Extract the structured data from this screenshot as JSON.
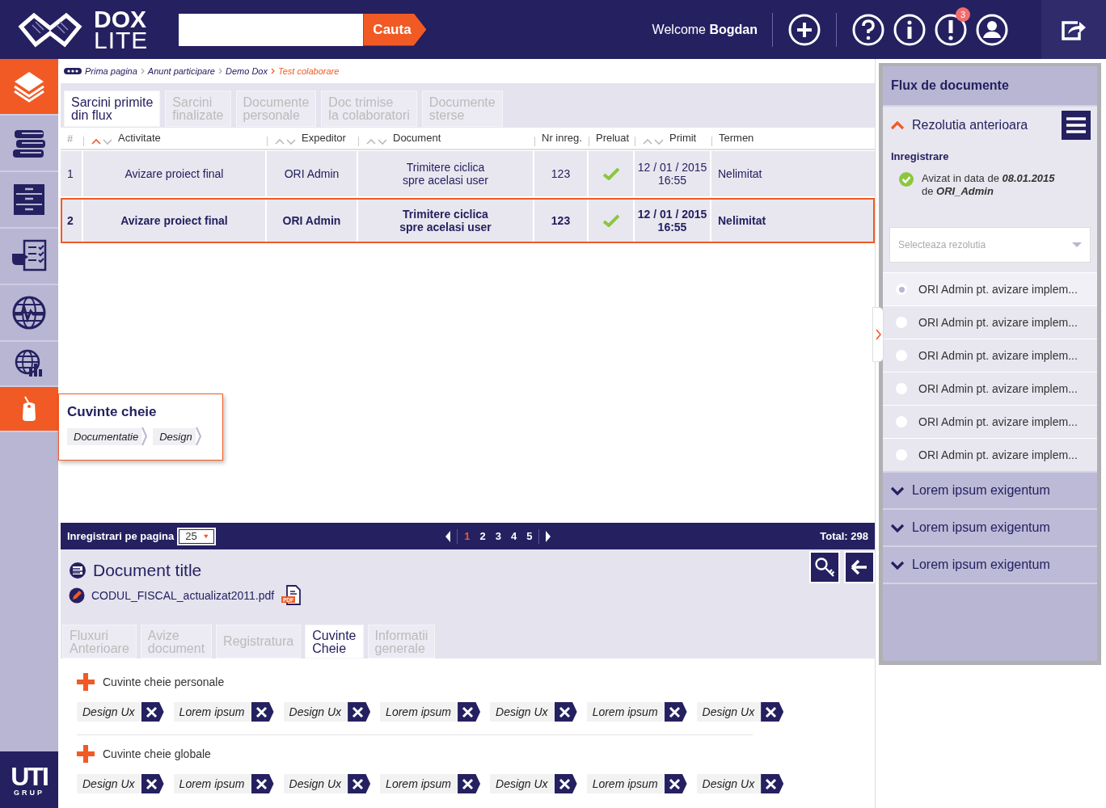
{
  "header": {
    "logo": {
      "top": "DOX",
      "bottom": "LITE"
    },
    "search": {
      "button": "Cauta"
    },
    "welcome": "Welcome **Bogdan**",
    "notification_badge": "3"
  },
  "sidebar": {
    "items": [
      {
        "kind": "layers",
        "selected": true
      },
      {
        "kind": "books",
        "selected": false
      },
      {
        "kind": "cabinet",
        "selected": false
      },
      {
        "kind": "checklist",
        "selected": false
      },
      {
        "kind": "globe",
        "selected": false
      },
      {
        "kind": "globe-chart",
        "selected": false
      },
      {
        "kind": "tag",
        "selected": true
      }
    ],
    "footer_logo": {
      "top": "UTI",
      "bottom": "GRUP"
    }
  },
  "breadcrumb": [
    {
      "label": "Prima pagina",
      "current": false
    },
    {
      "label": "Anunt participare",
      "current": false
    },
    {
      "label": "Demo Dox",
      "current": false
    },
    {
      "label": "Test colaborare",
      "current": true
    }
  ],
  "tabs": [
    {
      "label": "Sarcini primite\ndin flux",
      "selected": true
    },
    {
      "label": "Sarcini\nfinalizate",
      "selected": false
    },
    {
      "label": "Documente\npersonale",
      "selected": false
    },
    {
      "label": "Doc trimise\nla colaboratori",
      "selected": false
    },
    {
      "label": "Documente\nsterse",
      "selected": false
    }
  ],
  "table": {
    "columns": [
      {
        "label": "#",
        "sortable": false
      },
      {
        "label": "Activitate",
        "sorted": true,
        "sortable": true
      },
      {
        "label": "Expeditor",
        "sorted": false,
        "sortable": true
      },
      {
        "label": "Document",
        "sorted": false,
        "sortable": true
      },
      {
        "label": "Nr inreg.",
        "sortable": false
      },
      {
        "label": "Preluat",
        "sortable": false
      },
      {
        "label": "Primit",
        "sorted": false,
        "sortable": true
      },
      {
        "label": "Termen",
        "sortable": false
      }
    ],
    "rows": [
      {
        "number": "1",
        "activity": "Avizare proiect final",
        "sender": "ORI Admin",
        "document": "Trimitere ciclica\nspre acelasi user",
        "reg_no": "123",
        "taken": true,
        "date": "12 / 01 / 2015",
        "time": "16:55",
        "deadline": "Nelimitat",
        "selected": false
      },
      {
        "number": "2",
        "activity": "Avizare proiect final",
        "sender": "ORI Admin",
        "document": "Trimitere ciclica\nspre acelasi user",
        "reg_no": "123",
        "taken": true,
        "date": "12 / 01 / 2015",
        "time": "16:55",
        "deadline": "Nelimitat",
        "selected": true
      }
    ]
  },
  "keyword_popup": {
    "title": "Cuvinte cheie",
    "tags": [
      "Documentatie",
      "Design"
    ]
  },
  "pagination": {
    "label": "Inregistrari pe pagina",
    "per_page": "25",
    "pages": [
      {
        "label": "1",
        "selected": true
      },
      {
        "label": "2",
        "selected": false
      },
      {
        "label": "3",
        "selected": false
      },
      {
        "label": "4",
        "selected": false
      },
      {
        "label": "5",
        "selected": false
      }
    ],
    "total_label": "Total:",
    "total": "298"
  },
  "document": {
    "title": "Document title",
    "file": "CODUL_FISCAL_actualizat2011.pdf",
    "pdf_label": "PDF",
    "tabs": [
      {
        "label": "Fluxuri\nAnterioare",
        "selected": false
      },
      {
        "label": "Avize\ndocument",
        "selected": false
      },
      {
        "label": "Registratura",
        "selected": false
      },
      {
        "label": "Cuvinte\nCheie",
        "selected": true
      },
      {
        "label": "Informatii\ngenerale",
        "selected": false
      }
    ],
    "keyword_groups": [
      {
        "title": "Cuvinte cheie personale",
        "tags": [
          "Design Ux",
          "Lorem ipsum",
          "Design Ux",
          "Lorem ipsum",
          "Design Ux",
          "Lorem ipsum",
          "Design Ux"
        ]
      },
      {
        "title": "Cuvinte cheie globale",
        "tags": [
          "Design Ux",
          "Lorem ipsum",
          "Design Ux",
          "Lorem ipsum",
          "Design Ux",
          "Lorem ipsum",
          "Design Ux"
        ]
      }
    ]
  },
  "flow_panel": {
    "title": "Flux de documente",
    "sections": [
      {
        "title": "Rezolutia anterioara",
        "expanded": true,
        "content": {
          "heading": "Inregistrare",
          "status": "Avizat in data de **08.01.2015**\nde **ORI_Admin**",
          "select_placeholder": "Selecteaza rezolutia",
          "options": [
            {
              "label": "ORI Admin pt. avizare implem...",
              "selected": true
            },
            {
              "label": "ORI Admin pt. avizare implem...",
              "selected": false
            },
            {
              "label": "ORI Admin pt. avizare implem...",
              "selected": false
            },
            {
              "label": "ORI Admin pt. avizare implem...",
              "selected": false
            },
            {
              "label": "ORI Admin pt. avizare implem...",
              "selected": false
            },
            {
              "label": "ORI Admin pt. avizare implem...",
              "selected": false
            }
          ]
        }
      },
      {
        "title": "Lorem ipsum exigentum",
        "expanded": false
      },
      {
        "title": "Lorem ipsum exigentum",
        "expanded": false
      },
      {
        "title": "Lorem ipsum exigentum",
        "expanded": false
      }
    ]
  }
}
